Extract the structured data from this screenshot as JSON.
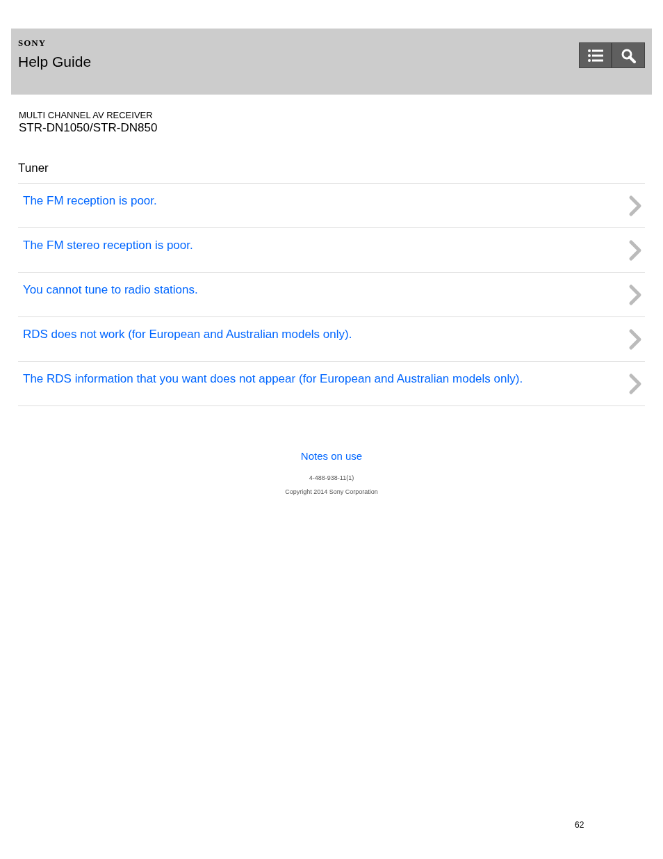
{
  "header": {
    "brand": "SONY",
    "title": "Help Guide"
  },
  "product": {
    "category": "MULTI CHANNEL AV RECEIVER",
    "model": "STR-DN1050/STR-DN850"
  },
  "section": {
    "title": "Tuner",
    "links": [
      {
        "label": "The FM reception is poor."
      },
      {
        "label": "The FM stereo reception is poor."
      },
      {
        "label": "You cannot tune to radio stations."
      },
      {
        "label": "RDS does not work (for European and Australian models only)."
      },
      {
        "label": "The RDS information that you want does not appear (for European and Australian models only)."
      }
    ]
  },
  "footer": {
    "link": "Notes on use",
    "code": "4-488-938-11(1)",
    "copyright": "Copyright 2014 Sony Corporation"
  },
  "page_number": "62"
}
